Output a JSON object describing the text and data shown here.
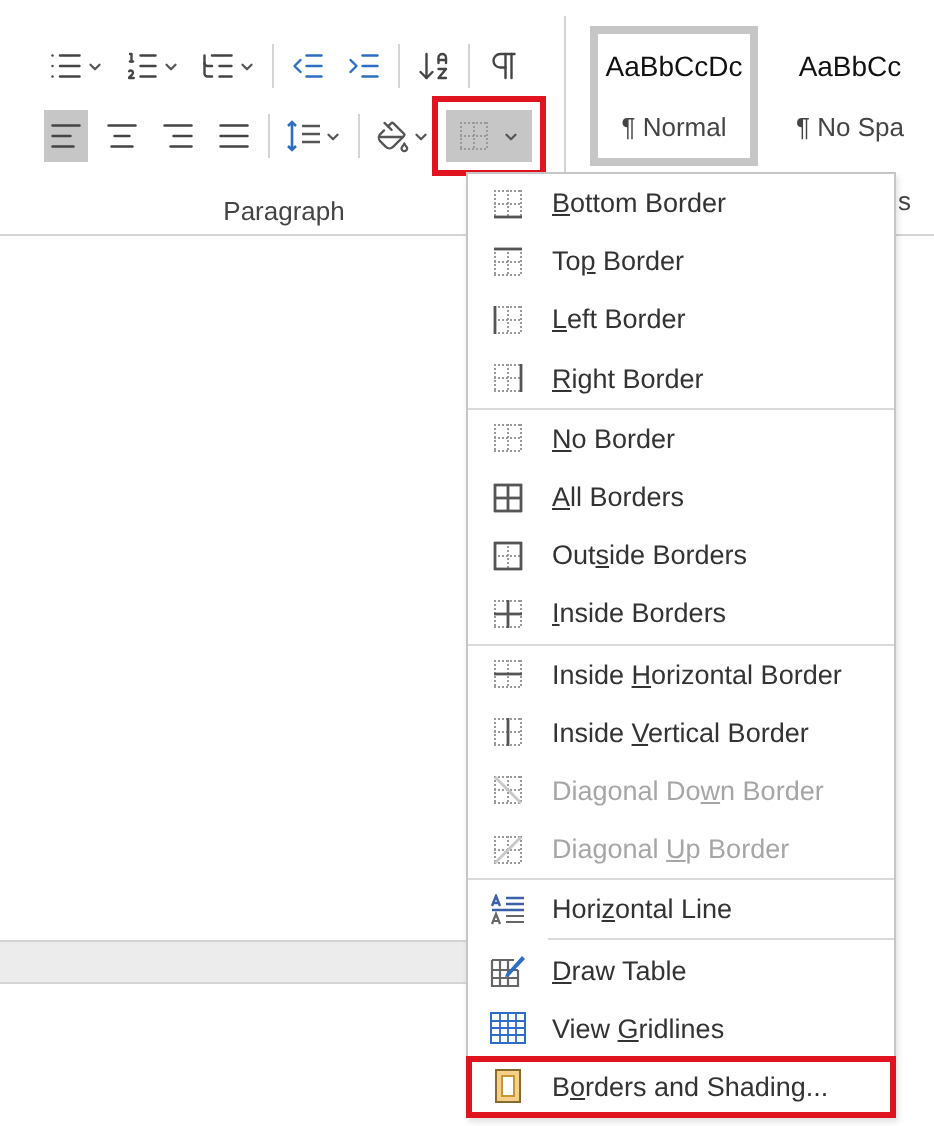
{
  "ribbon": {
    "row_1": [
      {
        "kind": "bullets",
        "has_caret": true
      },
      {
        "kind": "numbering",
        "has_caret": true
      },
      {
        "kind": "multilevel",
        "has_caret": true
      },
      {
        "kind": "divider"
      },
      {
        "kind": "outdent",
        "has_caret": false
      },
      {
        "kind": "indent",
        "has_caret": false
      },
      {
        "kind": "divider"
      },
      {
        "kind": "sort",
        "has_caret": false
      },
      {
        "kind": "divider"
      },
      {
        "kind": "pilcrow",
        "has_caret": false
      }
    ],
    "alignment": [
      {
        "kind": "left",
        "selected": true
      },
      {
        "kind": "center",
        "selected": false
      },
      {
        "kind": "right",
        "selected": false
      },
      {
        "kind": "justify",
        "selected": false
      }
    ],
    "borders_button": {
      "open": true
    },
    "group_label": "Paragraph",
    "styles": [
      {
        "preview": "AaBbCcDc",
        "name": "¶ Normal",
        "selected": true
      },
      {
        "preview": "AaBbCc",
        "name": "¶ No Spa",
        "selected": false
      }
    ],
    "styles_label": "s"
  },
  "menu": {
    "groups": [
      {
        "items": [
          {
            "key": "B",
            "after": "ottom Border",
            "disabled": false,
            "selected": false
          },
          {
            "before": "To",
            "key": "p",
            "after": " Border",
            "disabled": false,
            "selected": false
          },
          {
            "key": "L",
            "after": "eft Border",
            "disabled": false,
            "selected": false
          },
          {
            "key": "R",
            "after": "ight Border",
            "disabled": false,
            "selected": false
          }
        ]
      },
      {
        "indented_divider": false,
        "items": [
          {
            "key": "N",
            "after": "o Border",
            "disabled": false,
            "selected": false
          },
          {
            "key": "A",
            "after": "ll Borders",
            "disabled": false,
            "selected": false
          },
          {
            "before": "Out",
            "key": "s",
            "after": "ide Borders",
            "disabled": false,
            "selected": false
          },
          {
            "key": "I",
            "after": "nside Borders",
            "disabled": false,
            "selected": false
          }
        ]
      },
      {
        "indented_divider": false,
        "items": [
          {
            "before": "Inside ",
            "key": "H",
            "after": "orizontal Border",
            "disabled": false,
            "selected": false
          },
          {
            "before": "Inside ",
            "key": "V",
            "after": "ertical Border",
            "disabled": false,
            "selected": false
          },
          {
            "before": "Diagonal Do",
            "key": "w",
            "after": "n Border",
            "disabled": true,
            "selected": false
          },
          {
            "before": "Diagonal ",
            "key": "U",
            "after": "p Border",
            "disabled": true,
            "selected": false
          }
        ]
      },
      {
        "indented_divider": false,
        "items": [
          {
            "before": "Hori",
            "key": "z",
            "after": "ontal Line",
            "disabled": false,
            "selected": false
          }
        ]
      },
      {
        "indented_divider": true,
        "items": [
          {
            "key": "D",
            "after": "raw Table",
            "disabled": false,
            "selected": false
          },
          {
            "before": "View ",
            "key": "G",
            "after": "ridlines",
            "disabled": false,
            "selected": false
          },
          {
            "before": "B",
            "key": "o",
            "after": "rders and Shading...",
            "disabled": false,
            "selected": true
          }
        ]
      }
    ]
  }
}
